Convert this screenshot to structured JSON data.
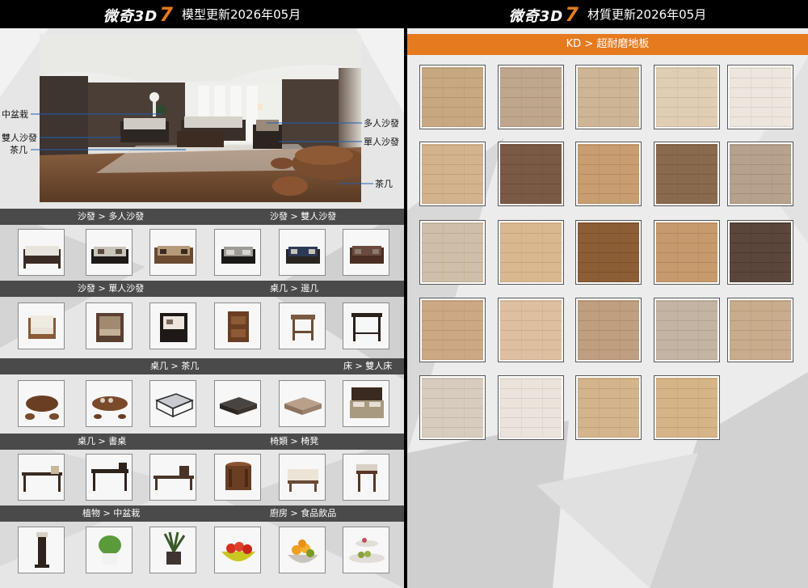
{
  "left": {
    "header": {
      "logo": "微奇3D",
      "logo_seven": "7",
      "title": "模型更新2026年05月"
    },
    "hero_labels": [
      "中盆栽",
      "雙人沙發",
      "茶几",
      "多人沙發",
      "單人沙發",
      "茶几"
    ],
    "sections": [
      {
        "cat1": "沙發 > 多人沙發",
        "cat2": "沙發 > 雙人沙發",
        "items": [
          "sofa-3seat-white",
          "sofa-3seat-dark",
          "sofa-3seat-wood",
          "sofa-2seat-gray",
          "sofa-2seat-navy",
          "sofa-2seat-brown"
        ]
      },
      {
        "cat1": "沙發 > 單人沙發",
        "cat2": "桌几 > 邊几",
        "items": [
          "armchair-cream",
          "armchair-carved",
          "armchair-dark",
          "side-table-round",
          "side-table-square",
          "side-table-tall"
        ]
      },
      {
        "cat1": "桌几 > 茶几",
        "cat2": "床 > 雙人床",
        "items": [
          "tea-table-root",
          "tea-table-carved",
          "coffee-table-glass",
          "coffee-table-dark",
          "coffee-table-wood",
          "double-bed"
        ]
      },
      {
        "cat1": "桌几 > 書桌",
        "cat2": "椅類 > 椅凳",
        "items": [
          "desk-long",
          "desk-shelf",
          "desk-low",
          "stool-drum",
          "bench-cushion",
          "stool-square"
        ]
      },
      {
        "cat1": "植物 > 中盆栽",
        "cat2": "廚房 > 食品飲品",
        "items": [
          "plant-stand",
          "plant-pot-green",
          "plant-pot-grass",
          "fruit-bowl-apples",
          "fruit-bowl-oranges",
          "fruit-tray-tier"
        ]
      }
    ]
  },
  "right": {
    "header": {
      "logo": "微奇3D",
      "logo_seven": "7",
      "title": "材質更新2026年05月"
    },
    "category": "KD > 超耐磨地板",
    "swatches": [
      {
        "name": "floor-1",
        "base": "#c8a880",
        "line": "#b79670"
      },
      {
        "name": "floor-2",
        "base": "#bfa78e",
        "line": "#ae957c"
      },
      {
        "name": "floor-3",
        "base": "#cdb596",
        "line": "#bba384"
      },
      {
        "name": "floor-4",
        "base": "#e0ceb4",
        "line": "#cdbba2"
      },
      {
        "name": "floor-5",
        "base": "#ece6de",
        "line": "#dad3ca"
      },
      {
        "name": "floor-6",
        "base": "#d2b38e",
        "line": "#c0a17c"
      },
      {
        "name": "floor-7",
        "base": "#7a5a44",
        "line": "#6a4c38"
      },
      {
        "name": "floor-8",
        "base": "#c89d70",
        "line": "#b68b60"
      },
      {
        "name": "floor-9",
        "base": "#8a6a4e",
        "line": "#795b41"
      },
      {
        "name": "floor-10",
        "base": "#b6a28c",
        "line": "#a4907a"
      },
      {
        "name": "floor-11",
        "base": "#cfbfa8",
        "line": "#bdad96"
      },
      {
        "name": "floor-12",
        "base": "#d9b890",
        "line": "#c7a67e"
      },
      {
        "name": "floor-13",
        "base": "#8c5e36",
        "line": "#7a4f2b"
      },
      {
        "name": "floor-14",
        "base": "#c69a6c",
        "line": "#b4885c"
      },
      {
        "name": "floor-15",
        "base": "#5a463a",
        "line": "#4c3a30"
      },
      {
        "name": "floor-16",
        "base": "#cda884",
        "line": "#bb9672"
      },
      {
        "name": "floor-17",
        "base": "#dec0a0",
        "line": "#ccae8e"
      },
      {
        "name": "floor-18",
        "base": "#c09e80",
        "line": "#ae8c6e"
      },
      {
        "name": "floor-19",
        "base": "#c4b4a4",
        "line": "#b2a292"
      },
      {
        "name": "floor-20",
        "base": "#c8ac8c",
        "line": "#b69a7a"
      },
      {
        "name": "floor-21",
        "base": "#d8ccbe",
        "line": "#c6baac"
      },
      {
        "name": "floor-22",
        "base": "#ebe4dc",
        "line": "#dad2c9"
      },
      {
        "name": "floor-23",
        "base": "#d4b48c",
        "line": "#c2a27a"
      },
      {
        "name": "floor-24",
        "base": "#d6b488",
        "line": "#c4a276"
      }
    ]
  },
  "colors": {
    "accent": "#e57a1e",
    "header_bg": "#000000",
    "bar_bg": "#4a4a4a"
  }
}
